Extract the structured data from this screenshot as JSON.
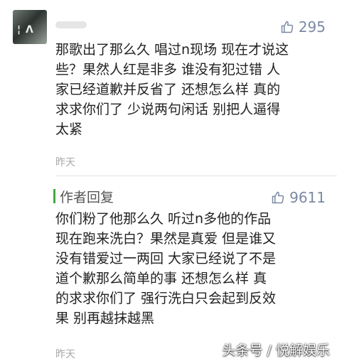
{
  "comment": {
    "likes": "295",
    "text": "那歌出了那么久 唱过n现场 现在才说这\n些？果然人红是非多 谁没有犯过错 人\n家已经道歉并反省了 还想怎么样 真的\n求求你们了 少说两句闲话 别把人逼得\n太紧",
    "time": "昨天"
  },
  "reply": {
    "label": "作者回复",
    "likes": "9611",
    "text": "你们粉了他那么久 听过n多他的作品\n现在跑来洗白？果然是真爱 但是谁又\n没有错爱过一两回 大家已经说了不是\n道个歉那么简单的事 还想怎么样 真\n的求求你们了 强行洗白只会起到反效\n果 别再越抹越黑",
    "time": "昨天"
  },
  "watermark": "头条号 / 悦解娱乐",
  "icons": {
    "like": "thumbs-up-icon"
  },
  "colors": {
    "like": "#7a8aa3",
    "reply_bar": "#47a840",
    "time": "#a8a8a8"
  }
}
